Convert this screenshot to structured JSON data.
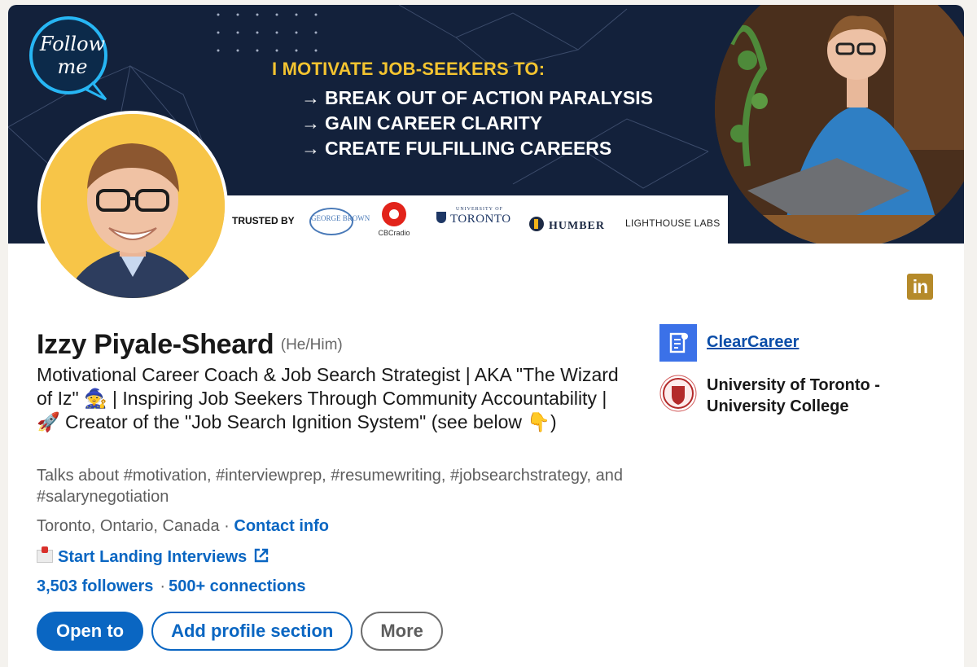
{
  "banner": {
    "follow_badge": "Follow me",
    "headline": "I MOTIVATE JOB-SEEKERS TO:",
    "goals": [
      "BREAK OUT OF ACTION PARALYSIS",
      "GAIN CAREER CLARITY",
      "CREATE FULFILLING CAREERS"
    ],
    "arrow_glyph": "→",
    "trusted_label": "TRUSTED BY",
    "trusted_logos": {
      "george_brown": "GEORGE BROWN",
      "cbc": "CBCradio",
      "uoft_small": "UNIVERSITY OF",
      "uoft_big": "TORONTO",
      "humber": "HUMBER",
      "lighthouse": "LIGHTHOUSE LABS"
    }
  },
  "profile": {
    "name": "Izzy Piyale-Sheard",
    "pronouns": "(He/Him)",
    "headline": "Motivational Career Coach & Job Search Strategist | AKA \"The Wizard of Iz\" 🧙 | Inspiring Job Seekers Through Community Accountability | 🚀 Creator of the \"Job Search Ignition System\" (see below 👇)",
    "talks_about": "Talks about #motivation, #interviewprep, #resumewriting, #jobsearchstrategy, and #salarynegotiation",
    "location": "Toronto, Ontario, Canada",
    "location_separator": " · ",
    "contact_info": "Contact info",
    "website_label": "Start Landing Interviews",
    "followers": "3,503 followers",
    "connections": "500+ connections",
    "stats_separator": "·"
  },
  "actions": {
    "open_to": "Open to",
    "add_section": "Add profile section",
    "more": "More"
  },
  "aside": {
    "company": "ClearCareer",
    "school": "University of Toronto - University College"
  },
  "badge": {
    "linkedin": "in"
  },
  "colors": {
    "primary": "#0a66c2",
    "banner_bg": "#13213b",
    "banner_accent": "#f4c430",
    "avatar_bg": "#f7c548"
  }
}
